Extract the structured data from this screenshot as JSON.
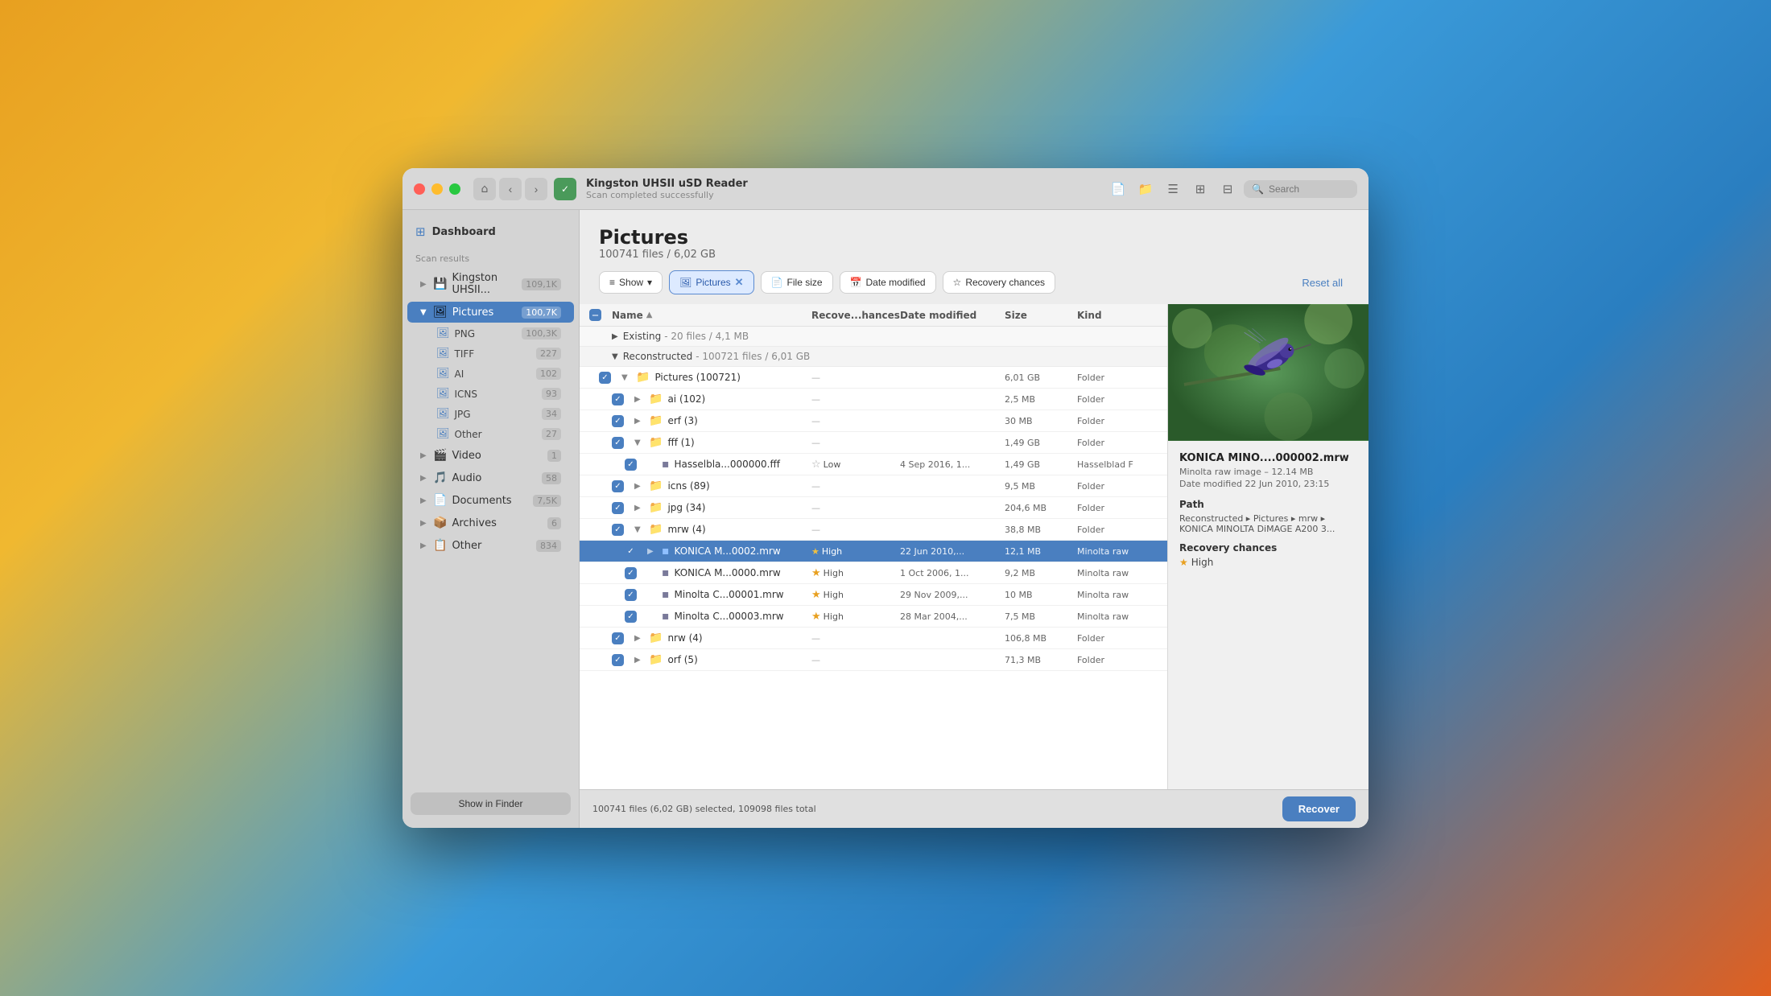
{
  "window": {
    "title": "Kingston UHSII uSD Reader",
    "subtitle": "Scan completed successfully"
  },
  "titlebar": {
    "back_label": "‹",
    "forward_label": "›",
    "home_label": "⌂",
    "check_label": "✓",
    "search_placeholder": "Search"
  },
  "sidebar": {
    "dashboard_label": "Dashboard",
    "scan_results_label": "Scan results",
    "device_label": "Kingston UHSII...",
    "device_count": "109,1K",
    "items": [
      {
        "id": "pictures",
        "label": "Pictures",
        "count": "100,7K",
        "selected": true,
        "expanded": true
      },
      {
        "id": "png",
        "label": "PNG",
        "count": "100,3K",
        "indent": true
      },
      {
        "id": "tiff",
        "label": "TIFF",
        "count": "227",
        "indent": true
      },
      {
        "id": "ai",
        "label": "AI",
        "count": "102",
        "indent": true
      },
      {
        "id": "icns",
        "label": "ICNS",
        "count": "93",
        "indent": true
      },
      {
        "id": "jpg",
        "label": "JPG",
        "count": "34",
        "indent": true
      },
      {
        "id": "other-pics",
        "label": "Other",
        "count": "27",
        "indent": true
      },
      {
        "id": "video",
        "label": "Video",
        "count": "1"
      },
      {
        "id": "audio",
        "label": "Audio",
        "count": "58"
      },
      {
        "id": "documents",
        "label": "Documents",
        "count": "7,5K"
      },
      {
        "id": "archives",
        "label": "Archives",
        "count": "6"
      },
      {
        "id": "other",
        "label": "Other",
        "count": "834"
      }
    ],
    "show_in_finder": "Show in Finder"
  },
  "content": {
    "title": "Pictures",
    "subtitle": "100741 files / 6,02 GB"
  },
  "filters": {
    "show_label": "Show",
    "pictures_label": "Pictures",
    "file_size_label": "File size",
    "date_modified_label": "Date modified",
    "recovery_chances_label": "Recovery chances",
    "reset_all_label": "Reset all"
  },
  "table": {
    "col_name": "Name",
    "col_recovery": "Recove...hances",
    "col_date": "Date modified",
    "col_size": "Size",
    "col_kind": "Kind",
    "groups": [
      {
        "label": "Existing",
        "info": "20 files / 4,1 MB",
        "expanded": false
      },
      {
        "label": "Reconstructed",
        "info": "100721 files / 6,01 GB",
        "expanded": true
      }
    ],
    "rows": [
      {
        "type": "folder",
        "indent": 1,
        "name": "Pictures (100721)",
        "recovery": "—",
        "date": "",
        "size": "6,01 GB",
        "kind": "Folder",
        "expanded": true,
        "checked": true
      },
      {
        "type": "folder",
        "indent": 2,
        "name": "ai (102)",
        "recovery": "—",
        "date": "",
        "size": "2,5 MB",
        "kind": "Folder",
        "expanded": false,
        "checked": true
      },
      {
        "type": "folder",
        "indent": 2,
        "name": "erf (3)",
        "recovery": "—",
        "date": "",
        "size": "30 MB",
        "kind": "Folder",
        "expanded": false,
        "checked": true
      },
      {
        "type": "folder",
        "indent": 2,
        "name": "fff (1)",
        "recovery": "—",
        "date": "",
        "size": "1,49 GB",
        "kind": "Folder",
        "expanded": true,
        "checked": true
      },
      {
        "type": "file",
        "indent": 3,
        "name": "Hasselbla...000000.fff",
        "recovery": "Low",
        "recovery_star": "outline",
        "date": "4 Sep 2016, 1...",
        "size": "1,49 GB",
        "kind": "Hasselblad F",
        "checked": true,
        "selected": false
      },
      {
        "type": "folder",
        "indent": 2,
        "name": "icns (89)",
        "recovery": "—",
        "date": "",
        "size": "9,5 MB",
        "kind": "Folder",
        "expanded": false,
        "checked": true
      },
      {
        "type": "folder",
        "indent": 2,
        "name": "jpg (34)",
        "recovery": "—",
        "date": "",
        "size": "204,6 MB",
        "kind": "Folder",
        "expanded": false,
        "checked": true
      },
      {
        "type": "folder",
        "indent": 2,
        "name": "mrw (4)",
        "recovery": "—",
        "date": "",
        "size": "38,8 MB",
        "kind": "Folder",
        "expanded": true,
        "checked": true
      },
      {
        "type": "file",
        "indent": 3,
        "name": "KONICA M...0002.mrw",
        "recovery": "High",
        "recovery_star": "filled",
        "date": "22 Jun 2010,...",
        "size": "12,1 MB",
        "kind": "Minolta raw",
        "checked": true,
        "selected": true
      },
      {
        "type": "file",
        "indent": 3,
        "name": "KONICA M...0000.mrw",
        "recovery": "High",
        "recovery_star": "filled",
        "date": "1 Oct 2006, 1...",
        "size": "9,2 MB",
        "kind": "Minolta raw",
        "checked": true,
        "selected": false
      },
      {
        "type": "file",
        "indent": 3,
        "name": "Minolta C...00001.mrw",
        "recovery": "High",
        "recovery_star": "filled",
        "date": "29 Nov 2009,...",
        "size": "10 MB",
        "kind": "Minolta raw",
        "checked": true,
        "selected": false
      },
      {
        "type": "file",
        "indent": 3,
        "name": "Minolta C...00003.mrw",
        "recovery": "High",
        "recovery_star": "filled",
        "date": "28 Mar 2004,...",
        "size": "7,5 MB",
        "kind": "Minolta raw",
        "checked": true,
        "selected": false
      },
      {
        "type": "folder",
        "indent": 2,
        "name": "nrw (4)",
        "recovery": "—",
        "date": "",
        "size": "106,8 MB",
        "kind": "Folder",
        "expanded": false,
        "checked": true
      },
      {
        "type": "folder",
        "indent": 2,
        "name": "orf (5)",
        "recovery": "—",
        "date": "",
        "size": "71,3 MB",
        "kind": "Folder",
        "expanded": false,
        "checked": true
      }
    ]
  },
  "detail": {
    "filename": "KONICA MINO....000002.mrw",
    "type": "Minolta raw image",
    "size": "12.14 MB",
    "date_modified": "Date modified 22 Jun 2010, 23:15",
    "path_title": "Path",
    "path": "Reconstructed ▸ Pictures ▸ mrw ▸ KONICA MINOLTA DiMAGE A200 3...",
    "recovery_title": "Recovery chances",
    "recovery_value": "High"
  },
  "statusbar": {
    "text": "100741 files (6,02 GB) selected, 109098 files total",
    "recover_label": "Recover"
  }
}
